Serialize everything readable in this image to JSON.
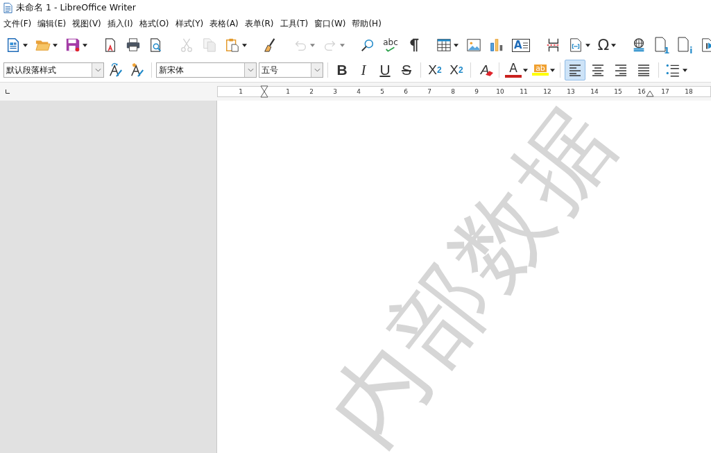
{
  "window": {
    "title": "未命名 1 - LibreOffice Writer"
  },
  "menu": [
    "文件(F)",
    "编辑(E)",
    "视图(V)",
    "插入(I)",
    "格式(O)",
    "样式(Y)",
    "表格(A)",
    "表单(R)",
    "工具(T)",
    "窗口(W)",
    "帮助(H)"
  ],
  "standard_toolbar": [
    {
      "kind": "new",
      "disabled": false
    },
    {
      "kind": "open",
      "disabled": false
    },
    {
      "kind": "save",
      "disabled": false
    },
    {
      "kind": "separator"
    },
    {
      "kind": "export-pdf",
      "disabled": false
    },
    {
      "kind": "print",
      "disabled": false
    },
    {
      "kind": "print-preview",
      "disabled": false
    },
    {
      "kind": "separator"
    },
    {
      "kind": "cut",
      "disabled": true
    },
    {
      "kind": "copy",
      "disabled": true
    },
    {
      "kind": "paste",
      "disabled": false
    },
    {
      "kind": "separator"
    },
    {
      "kind": "clone",
      "disabled": false
    },
    {
      "kind": "separator"
    },
    {
      "kind": "undo",
      "disabled": true
    },
    {
      "kind": "redo",
      "disabled": true
    },
    {
      "kind": "separator"
    },
    {
      "kind": "find",
      "disabled": false
    },
    {
      "kind": "spellcheck",
      "label": "abc",
      "disabled": false
    },
    {
      "kind": "formatting-marks",
      "disabled": false
    },
    {
      "kind": "separator"
    },
    {
      "kind": "table",
      "disabled": false
    },
    {
      "kind": "image",
      "disabled": false
    },
    {
      "kind": "chart",
      "disabled": false
    },
    {
      "kind": "textbox",
      "label": "A",
      "disabled": false
    },
    {
      "kind": "separator"
    },
    {
      "kind": "page-break",
      "disabled": false
    },
    {
      "kind": "field",
      "disabled": false
    },
    {
      "kind": "special-character",
      "label": "Ω",
      "disabled": false
    },
    {
      "kind": "separator"
    },
    {
      "kind": "hyperlink",
      "disabled": false
    },
    {
      "kind": "footnote",
      "label": "1",
      "disabled": false
    },
    {
      "kind": "endnote",
      "label": "i",
      "disabled": false
    },
    {
      "kind": "play",
      "disabled": false
    }
  ],
  "formatting_toolbar": [
    {
      "kind": "paragraph-style",
      "value": "默认段落样式"
    },
    {
      "kind": "update-style"
    },
    {
      "kind": "new-style"
    },
    {
      "kind": "separator"
    },
    {
      "kind": "font-name",
      "value": "新宋体"
    },
    {
      "kind": "font-size",
      "value": "五号"
    },
    {
      "kind": "separator"
    },
    {
      "kind": "bold",
      "label": "B"
    },
    {
      "kind": "italic",
      "label": "I"
    },
    {
      "kind": "underline",
      "label": "U"
    },
    {
      "kind": "strikethrough",
      "label": "S"
    },
    {
      "kind": "separator"
    },
    {
      "kind": "superscript",
      "base": "X",
      "mark": "2"
    },
    {
      "kind": "subscript",
      "base": "X",
      "mark": "2"
    },
    {
      "kind": "separator"
    },
    {
      "kind": "clear-format",
      "label": "A"
    },
    {
      "kind": "separator"
    },
    {
      "kind": "font-color",
      "label": "A"
    },
    {
      "kind": "highlight",
      "label": "ab"
    },
    {
      "kind": "separator"
    },
    {
      "kind": "align-left",
      "selected": true
    },
    {
      "kind": "align-center",
      "selected": false
    },
    {
      "kind": "align-right",
      "selected": false
    },
    {
      "kind": "align-justify",
      "selected": false
    },
    {
      "kind": "separator"
    },
    {
      "kind": "list"
    }
  ],
  "ruler": {
    "labels": [
      "1",
      "1",
      "2",
      "3",
      "4",
      "5",
      "6",
      "7",
      "8",
      "9",
      "10",
      "11",
      "12",
      "13",
      "14",
      "15",
      "16",
      "17",
      "18"
    ]
  },
  "document": {
    "watermark": "内部数据"
  }
}
